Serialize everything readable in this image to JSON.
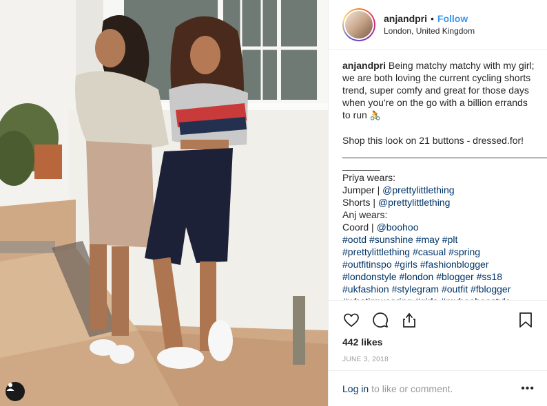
{
  "header": {
    "username": "anjandpri",
    "separator": "•",
    "follow_label": "Follow",
    "location": "London, United Kingdom"
  },
  "caption": {
    "username": "anjandpri",
    "text": "Being matchy matchy with my girl; we are both loving the current cycling shorts trend, super comfy and great for those days when you're on the go with a billion errands to run",
    "emoji": "🚴",
    "shop_line": "Shop this look on 21 buttons - dressed.for!",
    "divider": "________________________________________",
    "divider2": "_______",
    "priya_wears": "Priya wears:",
    "jumper_label": "Jumper |",
    "jumper_tag": "@prettylittlething",
    "shorts_label": "Shorts |",
    "shorts_tag": "@prettylittlething",
    "anj_wears": "Anj wears:",
    "coord_label": "Coord |",
    "coord_tag": "@boohoo",
    "hashtag_lines": [
      [
        "#ootd",
        "#sunshine",
        "#may",
        "#plt"
      ],
      [
        "#prettylittlething",
        "#casual",
        "#spring"
      ],
      [
        "#outfitinspo",
        "#girls",
        "#fashionblogger"
      ],
      [
        "#londonstyle",
        "#london",
        "#blogger",
        "#ss18"
      ],
      [
        "#ukfashion",
        "#stylegram",
        "#outfit",
        "#fblogger"
      ],
      [
        "#whatimwearing",
        "#girls",
        "#myboohoostyle"
      ]
    ]
  },
  "actions": {
    "icons": [
      "heart-icon",
      "comment-icon",
      "share-icon",
      "bookmark-icon"
    ],
    "likes": "442 likes",
    "date": "JUNE 3, 2018"
  },
  "footer": {
    "login_label": "Log in",
    "rest_text": "to like or comment.",
    "more_label": "•••"
  },
  "colors": {
    "link": "#3897f0",
    "hashtag": "#003569",
    "muted": "#999999"
  }
}
